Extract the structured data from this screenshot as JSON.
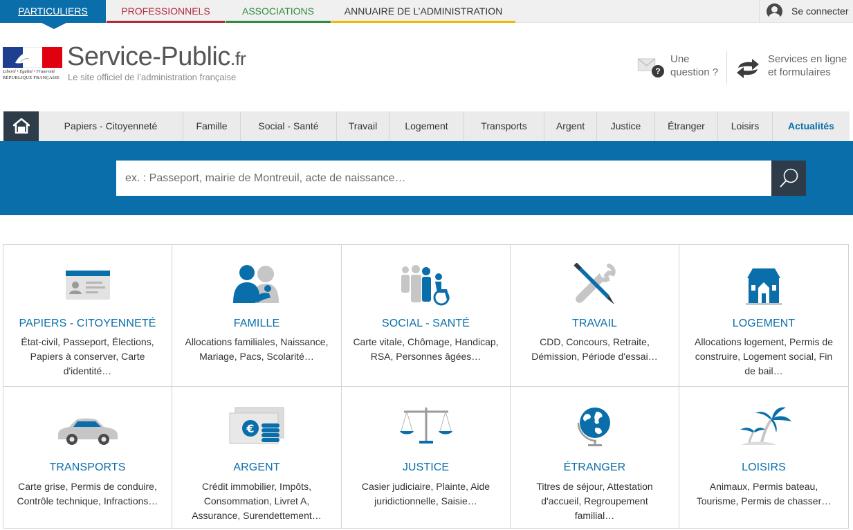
{
  "audience": {
    "particuliers": "PARTICULIERS",
    "professionnels": "PROFESSIONNELS",
    "associations": "ASSOCIATIONS",
    "annuaire": "ANNUAIRE DE L’ADMINISTRATION",
    "connect": "Se connecter"
  },
  "header": {
    "motto": "Liberté • Égalité • Fraternité",
    "republique": "RÉPUBLIQUE FRANÇAISE",
    "brand": "Service-Public",
    "brand_tld": ".fr",
    "tagline": "Le site officiel de l’administration française",
    "question_line1": "Une",
    "question_line2": "question ?",
    "services_line1": "Services en ligne",
    "services_line2": "et formulaires"
  },
  "nav": {
    "items": [
      "Papiers - Citoyenneté",
      "Famille",
      "Social - Santé",
      "Travail",
      "Logement",
      "Transports",
      "Argent",
      "Justice",
      "Étranger",
      "Loisirs",
      "Actualités"
    ]
  },
  "search": {
    "placeholder": "ex. : Passeport, mairie de Montreuil, acte de naissance…"
  },
  "themes": [
    {
      "title": "PAPIERS - CITOYENNETÉ",
      "desc": "État-civil, Passeport, Élections, Papiers à conserver, Carte d'identité…",
      "icon": "id-card-icon"
    },
    {
      "title": "FAMILLE",
      "desc": "Allocations familiales, Naissance, Mariage, Pacs, Scolarité…",
      "icon": "family-icon"
    },
    {
      "title": "SOCIAL - SANTÉ",
      "desc": "Carte vitale, Chômage, Handicap, RSA, Personnes âgées…",
      "icon": "wheelchair-icon"
    },
    {
      "title": "TRAVAIL",
      "desc": "CDD, Concours, Retraite, Démission, Période d'essai…",
      "icon": "pen-wrench-icon"
    },
    {
      "title": "LOGEMENT",
      "desc": "Allocations logement, Permis de construire, Logement social, Fin de bail…",
      "icon": "house-icon"
    },
    {
      "title": "TRANSPORTS",
      "desc": "Carte grise, Permis de conduire, Contrôle technique, Infractions…",
      "icon": "car-icon"
    },
    {
      "title": "ARGENT",
      "desc": "Crédit immobilier, Impôts, Consommation, Livret A, Assurance, Surendettement…",
      "icon": "euro-coins-icon"
    },
    {
      "title": "JUSTICE",
      "desc": "Casier judiciaire, Plainte, Aide juridictionnelle, Saisie…",
      "icon": "scales-icon"
    },
    {
      "title": "ÉTRANGER",
      "desc": "Titres de séjour, Attestation d'accueil, Regroupement familial…",
      "icon": "globe-icon"
    },
    {
      "title": "LOISIRS",
      "desc": "Animaux, Permis bateau, Tourisme, Permis de chasser…",
      "icon": "palm-tree-icon"
    }
  ],
  "colors": {
    "primary": "#0a6eaa",
    "dark": "#2e3c4a",
    "pro": "#b2283c",
    "asso": "#2e8b3e",
    "annuaire": "#f0b800"
  }
}
